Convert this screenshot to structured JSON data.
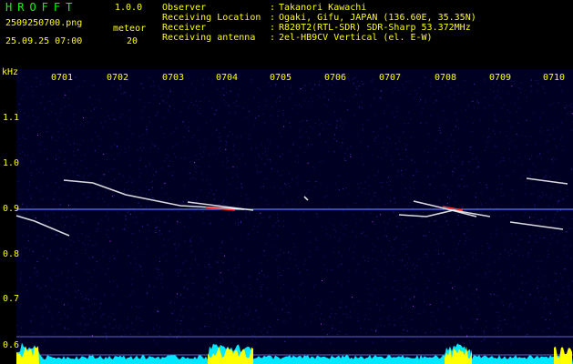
{
  "header": {
    "app_name": "HROFFT",
    "version": "1.0.0",
    "filename": "2509250700.png",
    "datetime": "25.09.25 07:00",
    "count_label": "meteor",
    "count_value": "20"
  },
  "info": [
    {
      "key": "Observer",
      "value": "Takanori Kawachi"
    },
    {
      "key": "Receiving Location",
      "value": "Ogaki, Gifu, JAPAN (136.60E, 35.35N)"
    },
    {
      "key": "Receiver",
      "value": "R820T2(RTL-SDR) SDR-Sharp 53.372MHz"
    },
    {
      "key": "Receiving antenna",
      "value": "2el-HB9CV Vertical (el. E-W)"
    }
  ],
  "axis": {
    "unit": "kHz",
    "x_ticks": [
      "0701",
      "0702",
      "0703",
      "0704",
      "0705",
      "0706",
      "0707",
      "0708",
      "0709",
      "0710"
    ],
    "y_ticks": [
      "1.1",
      "1.0",
      "0.9",
      "0.8",
      "0.7",
      "0.6"
    ]
  },
  "colors": {
    "label": "#ffff00",
    "title": "#00ff00",
    "background": "#000023",
    "carrier": "#5a78ff",
    "meteor_trace": "#ffffff",
    "meteor_hot": "#ff3030",
    "band_fill": "#00e8ff",
    "band_peak": "#ffff00"
  }
}
